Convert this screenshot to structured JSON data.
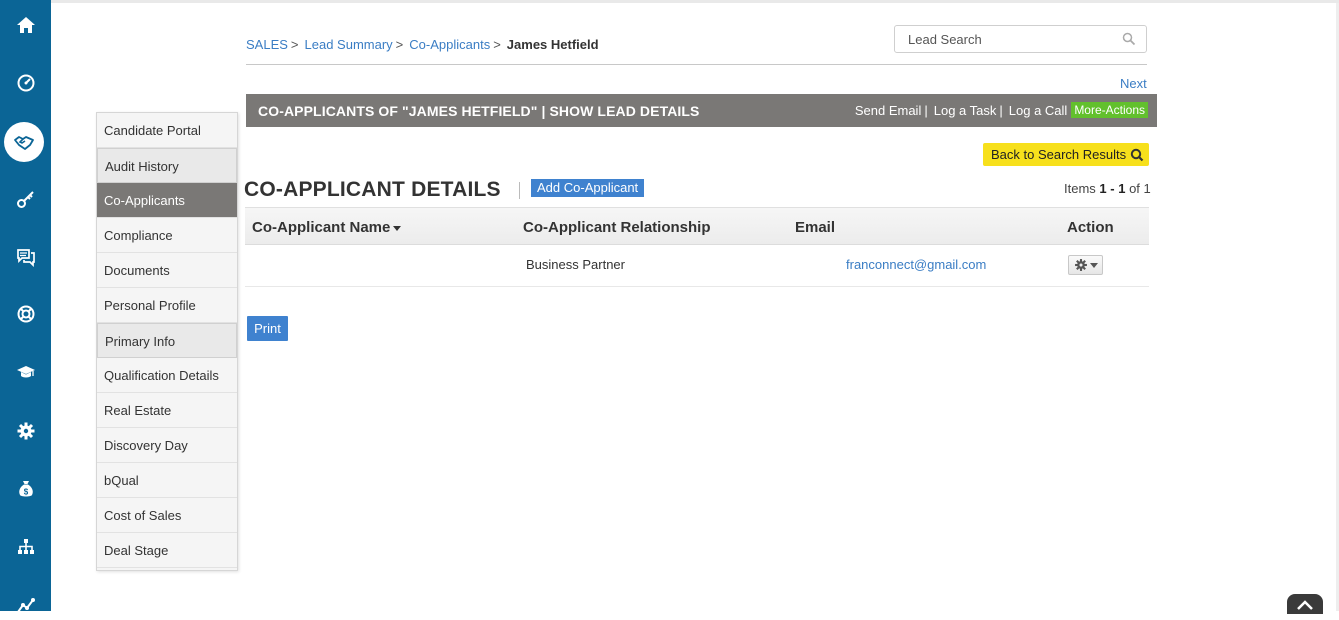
{
  "colors": {
    "rail": "#0b6596",
    "header_bar": "#7a7876",
    "link": "#3a7dc4",
    "accent_button": "#3f82cf",
    "more_actions": "#62c02d",
    "back_button": "#f7e01c"
  },
  "rail": {
    "icons": [
      "home-icon",
      "dashboard-icon",
      "handshake-icon",
      "key-icon",
      "chat-icon",
      "support-icon",
      "graduation-cap-icon",
      "gear-icon",
      "money-bag-icon",
      "org-chart-icon",
      "analytics-icon"
    ],
    "active": "handshake-icon"
  },
  "breadcrumb": {
    "items": [
      "SALES",
      "Lead Summary",
      "Co-Applicants"
    ],
    "separator": ">",
    "current": "James Hetfield"
  },
  "search": {
    "placeholder": "Lead Search"
  },
  "next_label": "Next",
  "header_bar": {
    "title": "CO-APPLICANTS OF \"JAMES HETFIELD\"",
    "show_lead_details": "| SHOW LEAD DETAILS",
    "actions": [
      "Send Email",
      "Log a Task",
      "Log a Call"
    ],
    "more_actions": "More-Actions"
  },
  "back_button": "Back to Search Results",
  "section": {
    "title": "CO-APPLICANT DETAILS",
    "add_button": "Add Co-Applicant",
    "items_prefix": "Items",
    "items_range": "1 - 1",
    "items_of": "of 1"
  },
  "table": {
    "columns": [
      "Co-Applicant Name",
      "Co-Applicant Relationship",
      "Email",
      "Action"
    ],
    "rows": [
      {
        "name": "",
        "relationship": "Business Partner",
        "email": "franconnect@gmail.com"
      }
    ]
  },
  "print_label": "Print",
  "sidenav": {
    "items": [
      "Candidate Portal",
      "Audit History",
      "Co-Applicants",
      "Compliance",
      "Documents",
      "Personal Profile",
      "Primary Info",
      "Qualification Details",
      "Real Estate",
      "Discovery Day",
      "bQual",
      "Cost of Sales",
      "Deal Stage"
    ],
    "active": "Co-Applicants"
  }
}
